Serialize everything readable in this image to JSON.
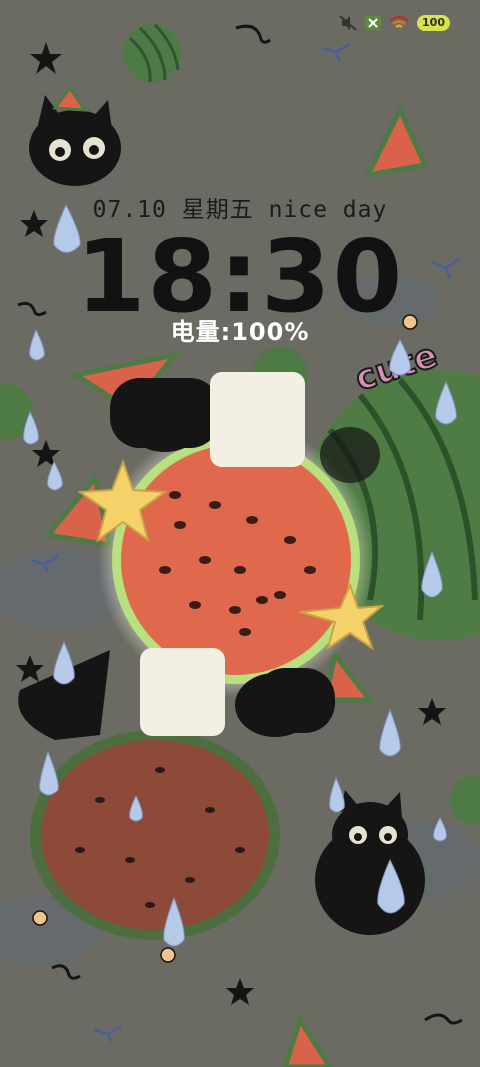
{
  "status_bar": {
    "icons": [
      "silent-mode-icon",
      "sim-disabled-icon",
      "wifi-icon"
    ],
    "battery_level": "100"
  },
  "lockscreen": {
    "date_line": "07.10 星期五 nice day",
    "time": "18:30",
    "battery_text": "电量:100%"
  },
  "wallpaper": {
    "sticker_text": "cute",
    "colors": {
      "background": "#6b6b63",
      "watermelon_flesh": "#e0684c",
      "rind": "#4d7a45",
      "cat": "#151515",
      "star": "#f4d169",
      "drop": "#b6c9e8"
    }
  }
}
